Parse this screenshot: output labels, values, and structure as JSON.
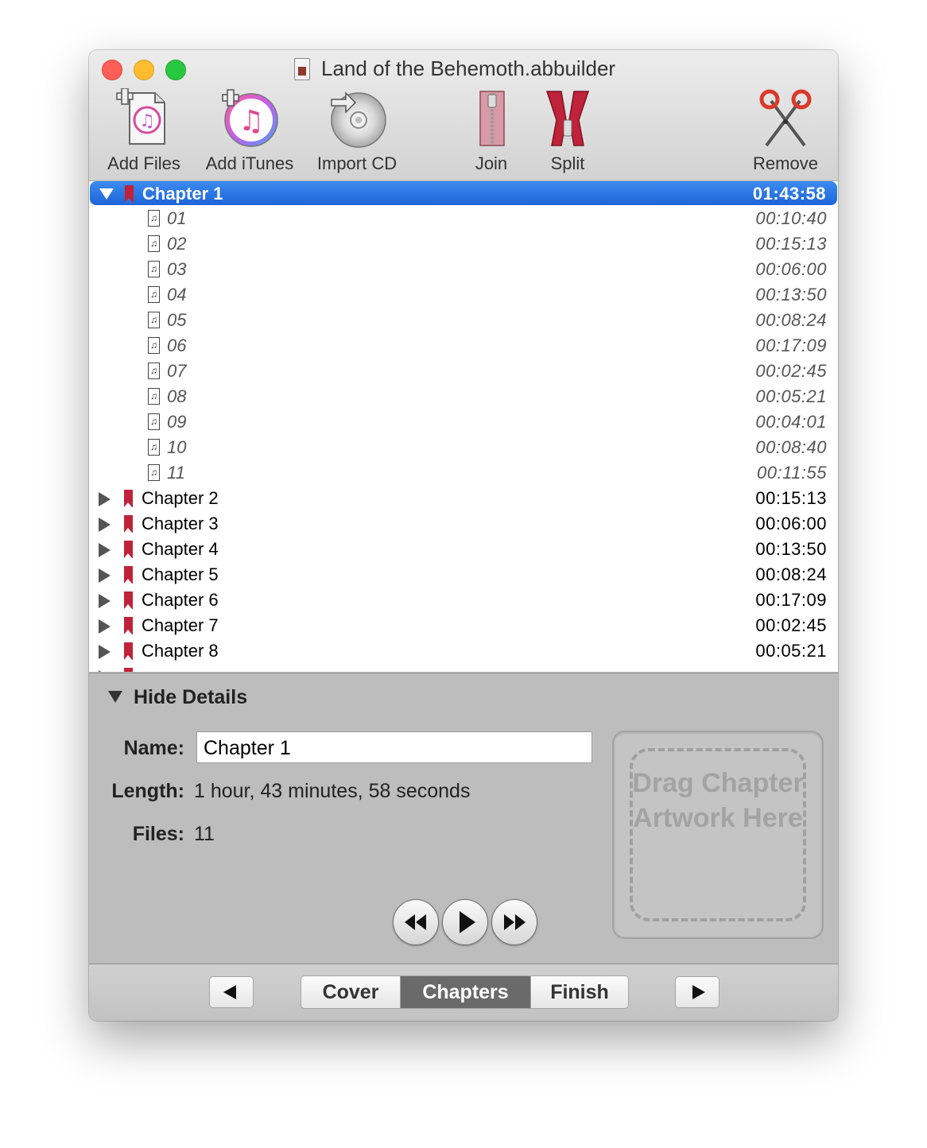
{
  "window": {
    "title": "Land of the Behemoth.abbuilder"
  },
  "toolbar": {
    "add_files": "Add Files",
    "add_itunes": "Add iTunes",
    "import_cd": "Import CD",
    "join": "Join",
    "split": "Split",
    "remove": "Remove"
  },
  "list": {
    "selected_chapter": {
      "name": "Chapter 1",
      "time": "01:43:58"
    },
    "files": [
      {
        "name": "01",
        "time": "00:10:40"
      },
      {
        "name": "02",
        "time": "00:15:13"
      },
      {
        "name": "03",
        "time": "00:06:00"
      },
      {
        "name": "04",
        "time": "00:13:50"
      },
      {
        "name": "05",
        "time": "00:08:24"
      },
      {
        "name": "06",
        "time": "00:17:09"
      },
      {
        "name": "07",
        "time": "00:02:45"
      },
      {
        "name": "08",
        "time": "00:05:21"
      },
      {
        "name": "09",
        "time": "00:04:01"
      },
      {
        "name": "10",
        "time": "00:08:40"
      },
      {
        "name": "11",
        "time": "00:11:55"
      }
    ],
    "chapters": [
      {
        "name": "Chapter 2",
        "time": "00:15:13"
      },
      {
        "name": "Chapter 3",
        "time": "00:06:00"
      },
      {
        "name": "Chapter 4",
        "time": "00:13:50"
      },
      {
        "name": "Chapter 5",
        "time": "00:08:24"
      },
      {
        "name": "Chapter 6",
        "time": "00:17:09"
      },
      {
        "name": "Chapter 7",
        "time": "00:02:45"
      },
      {
        "name": "Chapter 8",
        "time": "00:05:21"
      }
    ]
  },
  "details": {
    "toggle_label": "Hide Details",
    "name_label": "Name:",
    "name_value": "Chapter 1",
    "length_label": "Length:",
    "length_value": "1 hour, 43 minutes, 58 seconds",
    "files_label": "Files:",
    "files_value": "11",
    "artwork_placeholder": "Drag Chapter Artwork Here"
  },
  "bottom": {
    "tabs": [
      "Cover",
      "Chapters",
      "Finish"
    ],
    "active_tab": "Chapters"
  },
  "colors": {
    "selection": "#1c64d8",
    "bookmark": "#c0223a",
    "active_tab": "#6a6a6a"
  }
}
